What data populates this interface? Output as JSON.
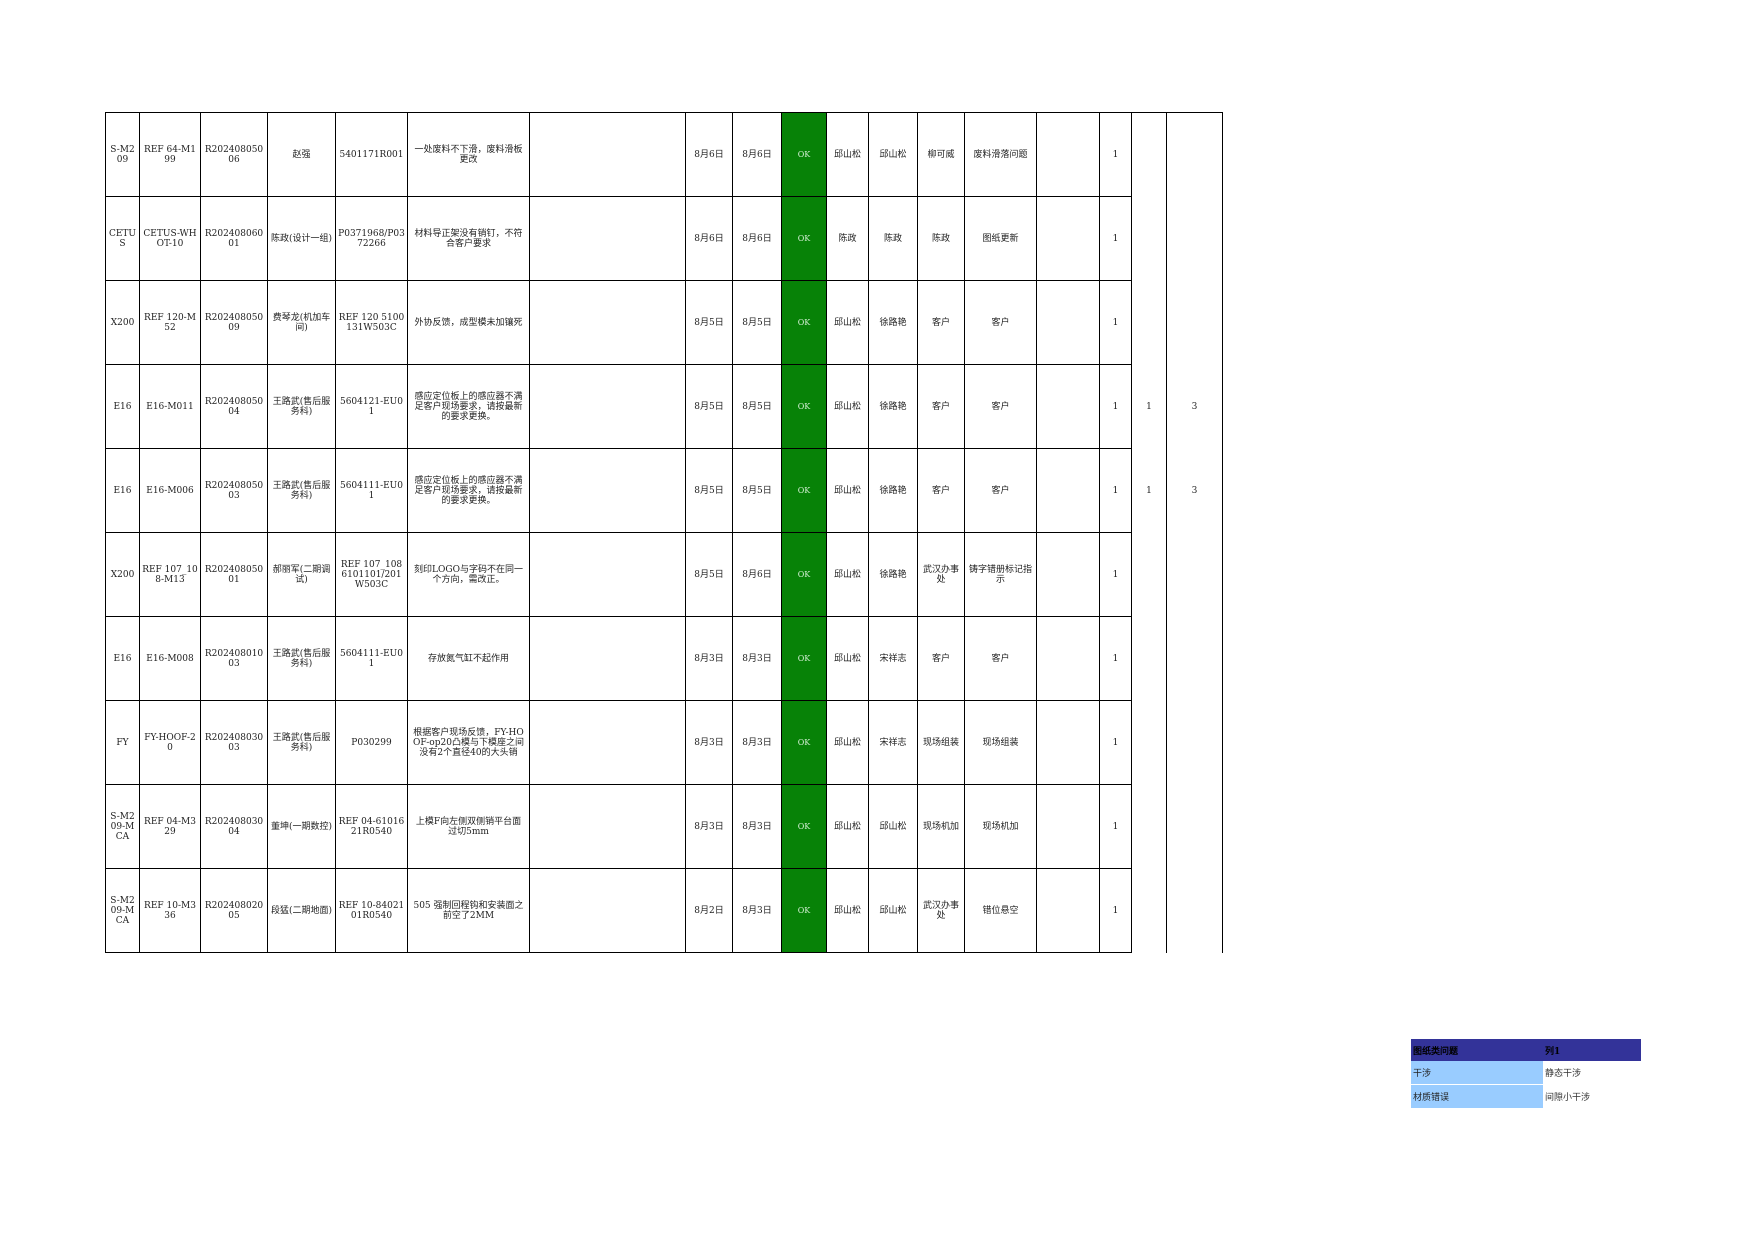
{
  "rows": [
    {
      "model": "S-M209",
      "ref": "REF 64-M199",
      "code": "R20240805006",
      "person": "赵强",
      "part": "5401171R001",
      "desc": "一处废料不下滑，废料滑板更改",
      "d1": "8月6日",
      "d2": "8月6日",
      "status": "OK",
      "p1": "邱山松",
      "p2": "邱山松",
      "p3": "柳可威",
      "cat": "废料滑落问题",
      "n1": "1",
      "n2": "",
      "n3": ""
    },
    {
      "model": "CETUS",
      "ref": "CETUS-WHOT-10",
      "code": "R20240806001",
      "person": "陈政(设计一组)",
      "part": "P0371968/P0372266",
      "desc": "材料导正架没有销钉，不符合客户要求",
      "d1": "8月6日",
      "d2": "8月6日",
      "status": "OK",
      "p1": "陈政",
      "p2": "陈政",
      "p3": "陈政",
      "cat": "图纸更新",
      "n1": "1",
      "n2": "",
      "n3": ""
    },
    {
      "model": "X200",
      "ref": "REF 120-M52",
      "code": "R20240805009",
      "person": "费琴龙(机加车间)",
      "part": "REF 120 5100131W503C",
      "desc": "外协反馈，成型模未加镶死",
      "d1": "8月5日",
      "d2": "8月5日",
      "status": "OK",
      "p1": "邱山松",
      "p2": "徐路艳",
      "p3": "客户",
      "cat": "客户",
      "n1": "1",
      "n2": "",
      "n3": ""
    },
    {
      "model": "E16",
      "ref": "E16-M011",
      "code": "R20240805004",
      "person": "王路武(售后服务科)",
      "part": "5604121-EU01",
      "desc": "感应定位板上的感应器不满足客户现场要求，请按最新的要求更换。",
      "d1": "8月5日",
      "d2": "8月5日",
      "status": "OK",
      "p1": "邱山松",
      "p2": "徐路艳",
      "p3": "客户",
      "cat": "客户",
      "n1": "1",
      "n2": "1",
      "n3": "3"
    },
    {
      "model": "E16",
      "ref": "E16-M006",
      "code": "R20240805003",
      "person": "王路武(售后服务科)",
      "part": "5604111-EU01",
      "desc": "感应定位板上的感应器不满足客户现场要求，请按最新的要求更换。",
      "d1": "8月5日",
      "d2": "8月5日",
      "status": "OK",
      "p1": "邱山松",
      "p2": "徐路艳",
      "p3": "客户",
      "cat": "客户",
      "n1": "1",
      "n2": "1",
      "n3": "3"
    },
    {
      "model": "X200",
      "ref": "REF 107_108-M13",
      "code": "R20240805001",
      "person": "郝丽军(二期调试)",
      "part": "REF 107_108 6101101/201W503C",
      "desc": "刻印LOGO与字码不在同一个方向，需改正。",
      "d1": "8月5日",
      "d2": "8月6日",
      "status": "OK",
      "p1": "邱山松",
      "p2": "徐路艳",
      "p3": "武汉办事处",
      "cat": "铸字错册标记指示",
      "n1": "1",
      "n2": "",
      "n3": ""
    },
    {
      "model": "E16",
      "ref": "E16-M008",
      "code": "R20240801003",
      "person": "王路武(售后服务科)",
      "part": "5604111-EU01",
      "desc": "存放氮气缸不起作用",
      "d1": "8月3日",
      "d2": "8月3日",
      "status": "OK",
      "p1": "邱山松",
      "p2": "宋祥志",
      "p3": "客户",
      "cat": "客户",
      "n1": "1",
      "n2": "",
      "n3": ""
    },
    {
      "model": "FY",
      "ref": "FY-HOOF-20",
      "code": "R20240803003",
      "person": "王路武(售后服务科)",
      "part": "P030299",
      "desc": "根据客户现场反馈，FY-HOOF-op20凸模与下模座之间没有2个直径40的大头销",
      "d1": "8月3日",
      "d2": "8月3日",
      "status": "OK",
      "p1": "邱山松",
      "p2": "宋祥志",
      "p3": "现场组装",
      "cat": "现场组装",
      "n1": "1",
      "n2": "",
      "n3": ""
    },
    {
      "model": "S-M209-MCA",
      "ref": "REF 04-M329",
      "code": "R20240803004",
      "person": "董坤(一期数控)",
      "part": "REF 04-6101621R0540",
      "desc": "上模F向左侧双侧销平台面过切5mm",
      "d1": "8月3日",
      "d2": "8月3日",
      "status": "OK",
      "p1": "邱山松",
      "p2": "邱山松",
      "p3": "现场机加",
      "cat": "现场机加",
      "n1": "1",
      "n2": "",
      "n3": ""
    },
    {
      "model": "S-M209-MCA",
      "ref": "REF 10-M336",
      "code": "R20240802005",
      "person": "段猛(二期地面)",
      "part": "REF 10-8402101R0540",
      "desc": "505 强制回程钩和安装面之前空了2MM",
      "d1": "8月2日",
      "d2": "8月3日",
      "status": "OK",
      "p1": "邱山松",
      "p2": "邱山松",
      "p3": "武汉办事处",
      "cat": "错位悬空",
      "n1": "1",
      "n2": "",
      "n3": ""
    }
  ],
  "legend": {
    "header_key": "图纸类问题",
    "header_val": "列1",
    "items": [
      {
        "key": "干涉",
        "val": "静态干涉"
      },
      {
        "key": "材质错误",
        "val": "间隙小干涉"
      }
    ]
  },
  "colors": {
    "ok_fill": "#078207",
    "legend_header": "#333399",
    "legend_key": "#99ccff"
  }
}
